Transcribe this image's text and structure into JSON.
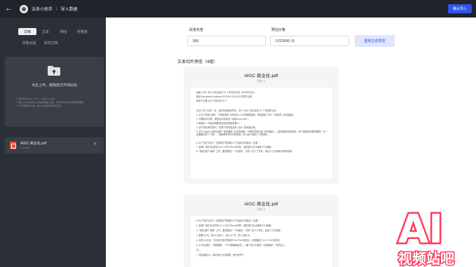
{
  "header": {
    "back_icon": "arrow-left-icon",
    "app_name": "法务小助手",
    "separator": "|",
    "page_name": "导入数据",
    "confirm_label": "确认导入"
  },
  "sidebar": {
    "tabs": [
      "文档",
      "文本",
      "网址",
      "问答链",
      "问答对话",
      "实时文档"
    ],
    "active_tab": "文档",
    "dropzone": {
      "title": "点击上传，或拖放文件到此处",
      "hints": [
        "1. 支持文件为 pdf、docx、txt 等 md 文档",
        "2. 建议 pdf 文件在新上传后经常确认拦截，可转为纯文本文档再更新网络",
        "3. 为了数据库文件格，建议上传的时间更有问题。"
      ]
    },
    "file": {
      "name": "AIGC 商业化.pdf",
      "size": "11.13 MB",
      "close_icon": "close-icon"
    }
  },
  "settings": {
    "chunk_length_label": "段落长度",
    "chunk_length_value": "500",
    "price_label": "预估价格",
    "price_value": "0.023041 元",
    "regenerate_label": "重新生成预览"
  },
  "preview": {
    "title": "文本切片预览（4组）",
    "cards": [
      {
        "title": "AIGC 商业化.pdf",
        "subtitle": "切片 1",
        "lines": [
          "深度 | 关于 AIGC 商业化的 13 个事件的认知（8000字长文）",
          "原创 han-timan hornbleue 2023-09-06 09:02 发表于云南",
          "谁来于去集 AIG 产品分析 16 个",
          "",
          "本文汇总了过去一年，我们在搜索世界中，关于 AIGC 商业化的 13 个非常的认知",
          "1. AIGC 的核心现状，不使用量扩大时间代入为1阶差额曲线，所处超前了多少 \"特化率\" (长远曲线)。",
          "2. 不要技术平等，而是技术实体的 \"功能Know-How\" 。",
          "3. 模组AI，可能会调整到目标的性能重要义。",
          "4. 对于特化率的提升，是按人类可能会有 \"巨大\" 的增量空间。",
          "5. 关于 Agent: 目前应用的 \"单体智能\" 意识有难题，可能的关键已装 \"多体智能——虚拟服务系统/电商，单个智能体可能有限限（不一定要超过多个人类），但能够有持久代的智慧（AI Agent 团队+人类团队）。",
          "6. AI 产品方法论之 \"选择用户表现成 AI 产品设计的最后一位置\" 。",
          "7. 品牌？现在并应有的 AI 2.0 的 \"iPhone时刻\"（第四层行业大模形 PK 局面）",
          "8. \"找着-跳户-满求\" 之外，要重做加一个关键词，\"关系\" 定义了关系，就定义了约束条件和需求量。"
        ]
      },
      {
        "title": "AIGC 商业化.pdf",
        "subtitle": "切片 2",
        "lines": [
          "5. AI 产品方法论之 \"选择用户表现成 AI 产品设计的最后一位置\" 。",
          "2. 品牌？现在并应有的 AI 2.0 的 \"iPhone时刻\"（第四层行业大模形 PK 局面）",
          "3. \"找着-跳户-满求\" 之外，要重做加一个关键词，\"关系\" 定义了关系，就定义了约束条",
          "4. 更要 AI 时，把 AI 当成人，设计 AI 时，把人当成 AI。",
          "5. 未来 AI 企业，方向定位需不需致作 ToC/ToB 新划分，而是聚焦 To A, TO AI 新划分",
          "6. AI 商业模式：不要短期，一千不能确确定的——要么是行分模式（定销卖求，打穿为止）",
          "   式）。",
          "7. 找初始模 AI，离对地行业所需要，而不差专门"
        ]
      }
    ]
  },
  "watermark": {
    "text_top": "AI",
    "text_bottom": "视频站吧",
    "color": "#ff3b5c"
  },
  "colors": {
    "accent": "#2f54eb",
    "topbar": "#20242b",
    "sidebar": "#2b2f36",
    "pdf": "#e34d45"
  }
}
